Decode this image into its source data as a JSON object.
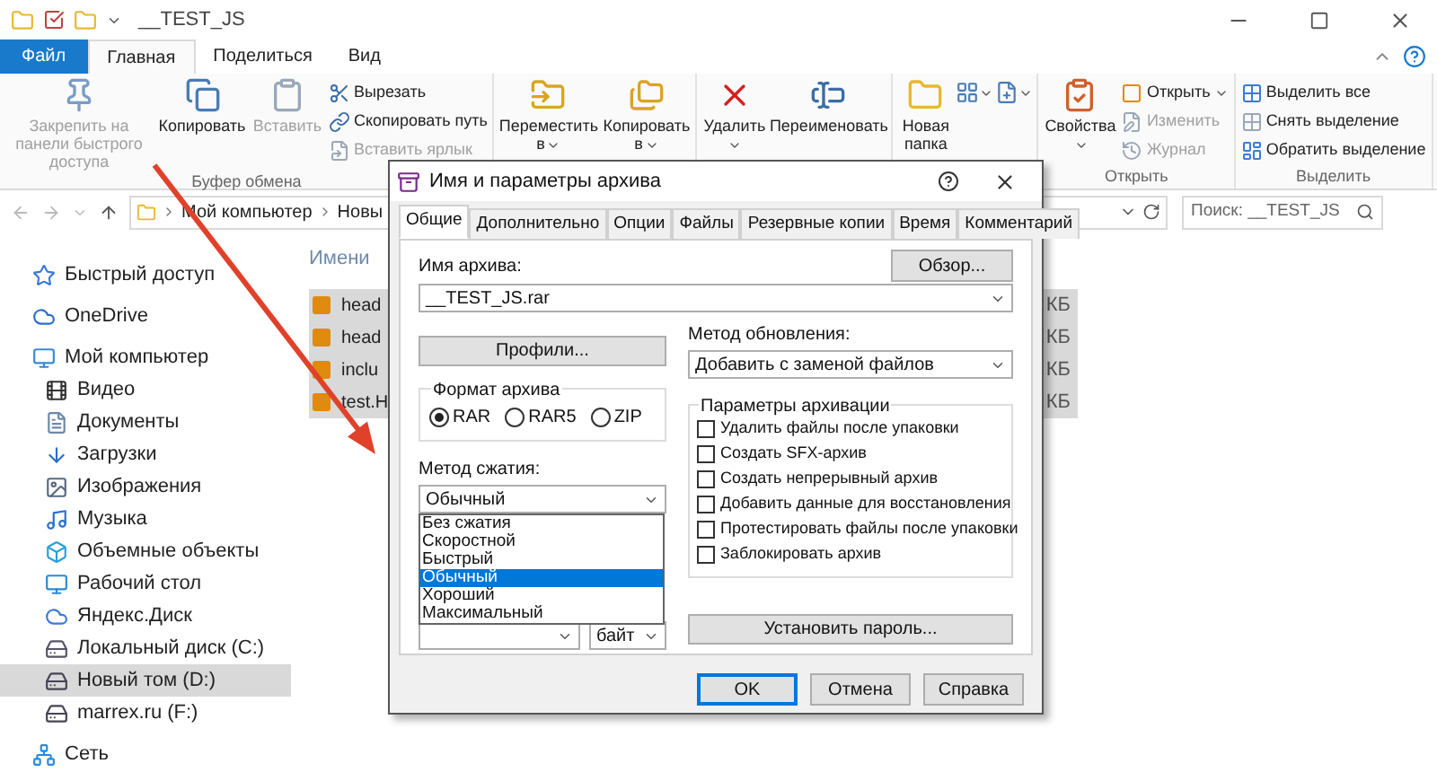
{
  "window": {
    "title": "__TEST_JS"
  },
  "ribbon": {
    "file_tab": "Файл",
    "tabs": [
      {
        "label": "Главная",
        "selected": true
      },
      {
        "label": "Поделиться",
        "selected": false
      },
      {
        "label": "Вид",
        "selected": false
      }
    ],
    "groups": [
      {
        "label": "Буфер обмена",
        "items": [
          {
            "kind": "large",
            "label": "Закрепить на панели быстрого доступа",
            "disabled": true,
            "dropdown": false
          },
          {
            "kind": "large",
            "label": "Копировать",
            "disabled": false,
            "dropdown": false
          },
          {
            "kind": "large",
            "label": "Вставить",
            "disabled": true,
            "dropdown": false
          },
          {
            "kind": "small",
            "label": "Вырезать",
            "disabled": false,
            "dropdown": false
          },
          {
            "kind": "small",
            "label": "Скопировать путь",
            "disabled": false,
            "dropdown": false
          },
          {
            "kind": "small",
            "label": "Вставить ярлык",
            "disabled": true,
            "dropdown": false
          }
        ]
      },
      {
        "items": [
          {
            "kind": "large",
            "label": "Переместить в",
            "disabled": false,
            "dropdown": true
          },
          {
            "kind": "large",
            "label": "Копировать в",
            "disabled": false,
            "dropdown": true
          }
        ]
      },
      {
        "items": [
          {
            "kind": "large",
            "label": "Удалить",
            "disabled": false,
            "dropdown": true
          },
          {
            "kind": "large",
            "label": "Переименовать",
            "disabled": false,
            "dropdown": false
          }
        ]
      },
      {
        "items": [
          {
            "kind": "large",
            "label": "Новая папка",
            "disabled": false,
            "dropdown": false
          },
          {
            "kind": "icon",
            "disabled": false,
            "dropdown": true
          },
          {
            "kind": "icon",
            "disabled": false,
            "dropdown": true
          }
        ]
      },
      {
        "label": "Открыть",
        "items": [
          {
            "kind": "large",
            "label": "Свойства",
            "disabled": false,
            "dropdown": true
          },
          {
            "kind": "small",
            "label": "Открыть",
            "disabled": false,
            "dropdown": true
          },
          {
            "kind": "small",
            "label": "Изменить",
            "disabled": true,
            "dropdown": false
          },
          {
            "kind": "small",
            "label": "Журнал",
            "disabled": true,
            "dropdown": false
          }
        ]
      },
      {
        "label": "Выделить",
        "items": [
          {
            "kind": "small",
            "label": "Выделить все",
            "disabled": false,
            "dropdown": false
          },
          {
            "kind": "small",
            "label": "Снять выделение",
            "disabled": false,
            "dropdown": false
          },
          {
            "kind": "small",
            "label": "Обратить выделение",
            "disabled": false,
            "dropdown": false
          }
        ]
      }
    ]
  },
  "address": {
    "path": [
      "Мой компьютер",
      "Новы"
    ],
    "search_placeholder": "Поиск: __TEST_JS"
  },
  "nav": [
    {
      "label": "Быстрый доступ",
      "selected": false
    },
    {
      "label": "OneDrive",
      "selected": false
    },
    {
      "label": "Мой компьютер",
      "selected": false,
      "children": [
        {
          "label": "Видео",
          "selected": false
        },
        {
          "label": "Документы",
          "selected": false
        },
        {
          "label": "Загрузки",
          "selected": false
        },
        {
          "label": "Изображения",
          "selected": false
        },
        {
          "label": "Музыка",
          "selected": false
        },
        {
          "label": "Объемные объекты",
          "selected": false
        },
        {
          "label": "Рабочий стол",
          "selected": false
        },
        {
          "label": "Яндекс.Диск",
          "selected": false
        },
        {
          "label": "Локальный диск (C:)",
          "selected": false
        },
        {
          "label": "Новый том (D:)",
          "selected": true
        },
        {
          "label": "marrex.ru (F:)",
          "selected": false
        }
      ]
    },
    {
      "label": "Сеть",
      "selected": false
    }
  ],
  "files": {
    "column_1": "Имени",
    "rows": [
      {
        "name": "head",
        "size": "КБ",
        "selected": true
      },
      {
        "name": "head",
        "size": "КБ",
        "selected": true
      },
      {
        "name": "inclu",
        "size": "КБ",
        "selected": true
      },
      {
        "name": "test.H",
        "size": "КБ",
        "selected": true
      }
    ]
  },
  "dialog": {
    "title": "Имя и параметры архива",
    "tabs": [
      {
        "label": "Общие",
        "selected": true
      },
      {
        "label": "Дополнительно",
        "selected": false
      },
      {
        "label": "Опции",
        "selected": false
      },
      {
        "label": "Файлы",
        "selected": false
      },
      {
        "label": "Резервные копии",
        "selected": false
      },
      {
        "label": "Время",
        "selected": false
      },
      {
        "label": "Комментарий",
        "selected": false
      }
    ],
    "archive_name": {
      "label": "Имя архива:",
      "value": "__TEST_JS.rar"
    },
    "browse_button": "Обзор...",
    "profiles_button": "Профили...",
    "update_method": {
      "label": "Метод обновления:",
      "value": "Добавить с заменой файлов"
    },
    "format": {
      "label": "Формат архива",
      "options": [
        {
          "label": "RAR",
          "selected": true
        },
        {
          "label": "RAR5",
          "selected": false
        },
        {
          "label": "ZIP",
          "selected": false
        }
      ]
    },
    "archive_options": {
      "label": "Параметры архивации",
      "items": [
        {
          "label": "Удалить файлы после упаковки",
          "checked": false
        },
        {
          "label": "Создать SFX-архив",
          "checked": false
        },
        {
          "label": "Создать непрерывный архив",
          "checked": false
        },
        {
          "label": "Добавить данные для восстановления",
          "checked": false
        },
        {
          "label": "Протестировать файлы после упаковки",
          "checked": false
        },
        {
          "label": "Заблокировать архив",
          "checked": false
        }
      ]
    },
    "compression": {
      "label": "Метод сжатия:",
      "value": "Обычный",
      "expanded": true,
      "options": [
        {
          "label": "Без сжатия",
          "selected": false
        },
        {
          "label": "Скоростной",
          "selected": false
        },
        {
          "label": "Быстрый",
          "selected": false
        },
        {
          "label": "Обычный",
          "selected": true
        },
        {
          "label": "Хороший",
          "selected": false
        },
        {
          "label": "Максимальный",
          "selected": false
        }
      ]
    },
    "volume_unit": "байт",
    "password_button": "Установить пароль...",
    "buttons": [
      {
        "label": "OK",
        "default": true
      },
      {
        "label": "Отмена",
        "default": false
      },
      {
        "label": "Справка",
        "default": false
      }
    ]
  }
}
